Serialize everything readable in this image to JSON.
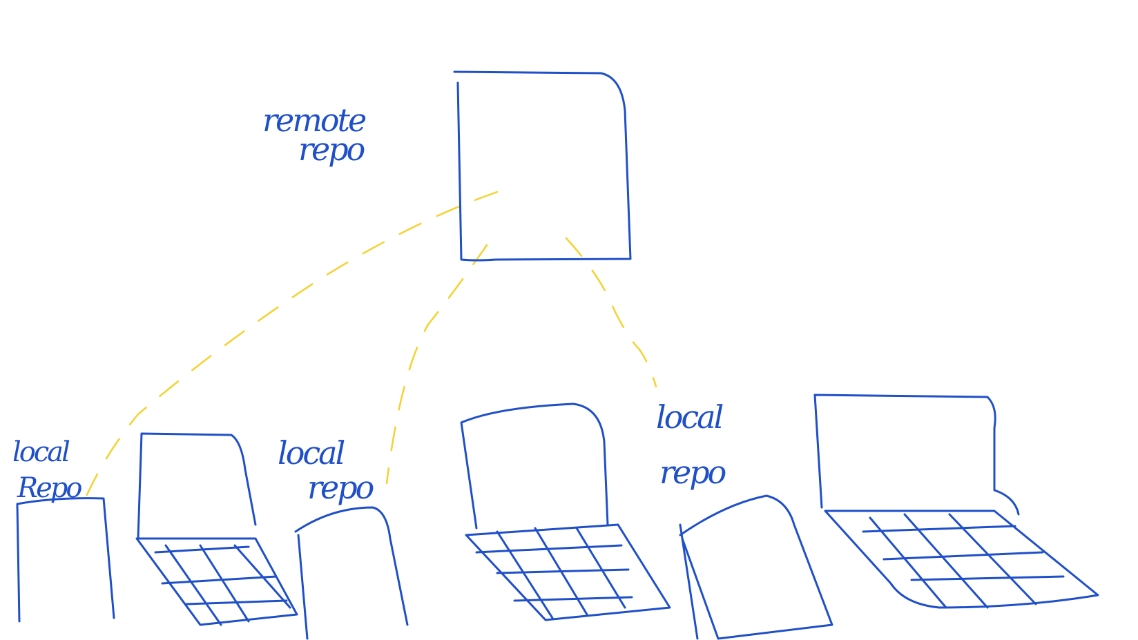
{
  "colors": {
    "ink": "#1f4fc9",
    "link": "#f5d22e",
    "background": "#ffffff"
  },
  "labels": {
    "remote_repo_line1": "remote",
    "remote_repo_line2": "repo",
    "local_1_line1": "local",
    "local_1_line2": "Repo",
    "local_2_line1": "local",
    "local_2_line2": "repo",
    "local_3_line1": "local",
    "local_3_line2": "repo"
  },
  "nodes": [
    {
      "id": "remote-repo",
      "kind": "server"
    },
    {
      "id": "laptop-1",
      "kind": "laptop"
    },
    {
      "id": "laptop-2",
      "kind": "laptop"
    },
    {
      "id": "laptop-3",
      "kind": "laptop"
    },
    {
      "id": "laptop-4",
      "kind": "laptop"
    }
  ],
  "edges": [
    {
      "from": "remote-repo",
      "to": "laptop-1"
    },
    {
      "from": "remote-repo",
      "to": "laptop-2"
    },
    {
      "from": "remote-repo",
      "to": "laptop-3"
    },
    {
      "from": "remote-repo",
      "to": "laptop-4"
    }
  ]
}
